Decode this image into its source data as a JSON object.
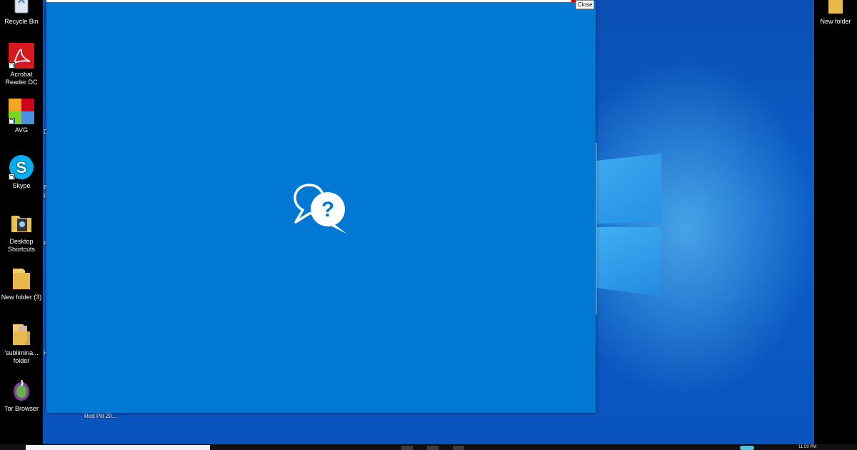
{
  "desktop": {
    "left_icons": [
      {
        "name": "recycle-bin",
        "label": "Recycle Bin",
        "icon": "recycle-bin-icon"
      },
      {
        "name": "acrobat-reader",
        "label": "Acrobat Reader DC",
        "icon": "acrobat-icon"
      },
      {
        "name": "avg",
        "label": "AVG",
        "icon": "avg-icon"
      },
      {
        "name": "skype",
        "label": "Skype",
        "icon": "skype-icon"
      },
      {
        "name": "desktop-shortcuts",
        "label": "Desktop Shortcuts",
        "icon": "folder-icon"
      },
      {
        "name": "new-folder-3",
        "label": "New folder (3)",
        "icon": "folder-icon"
      },
      {
        "name": "subliminal-folder",
        "label": "'sublimina... folder",
        "icon": "folder-icon"
      },
      {
        "name": "tor-browser",
        "label": "Tor Browser",
        "icon": "tor-icon"
      }
    ],
    "right_icons": [
      {
        "name": "new-folder",
        "label": "New folder",
        "icon": "folder-icon"
      }
    ],
    "side_letters": [
      "D",
      "E",
      "F",
      "F",
      "H"
    ],
    "red_pill_label": "Red Pill 20..."
  },
  "app_window": {
    "close_label": "Close",
    "center_icon": "chat-question-icon",
    "background": "#0078d4"
  },
  "taskbar": {
    "clock": "11:59 PM"
  },
  "colors": {
    "accent": "#0078d4",
    "taskbar": "#101010"
  }
}
